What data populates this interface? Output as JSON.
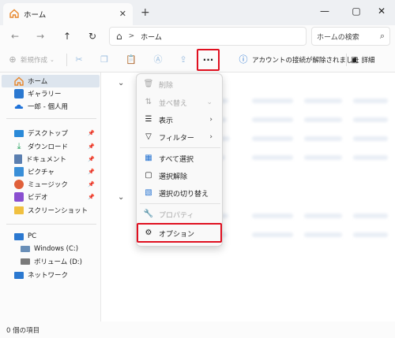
{
  "tab": {
    "title": "ホーム",
    "close": "✕",
    "new": "+"
  },
  "window": {
    "minimize": "—",
    "maximize": "▢",
    "close": "✕"
  },
  "nav": {
    "back": "←",
    "forward": "→",
    "up": "↑",
    "refresh": "↻"
  },
  "address": {
    "home_icon": "⌂",
    "separator": ">",
    "location": "ホーム"
  },
  "search": {
    "placeholder": "ホームの検索",
    "icon": "⌕"
  },
  "toolbar": {
    "new_label": "新規作成",
    "new_icon": "⊕",
    "more_label": "···",
    "info_text": "アカウントの接続が解除されました",
    "info_icon": "ⓘ",
    "detail_label": "詳細",
    "detail_icon": "▣"
  },
  "sidebar": {
    "items": [
      {
        "label": "ホーム",
        "icon": "home-icon",
        "color": "#e8862a"
      },
      {
        "label": "ギャラリー",
        "icon": "gallery-icon",
        "color": "#2b78d0"
      },
      {
        "label": "一郎 - 個人用",
        "icon": "onedrive-icon",
        "color": "#1f72d8"
      },
      {
        "label": "デスクトップ",
        "icon": "desktop-icon",
        "color": "#2b8ad8"
      },
      {
        "label": "ダウンロード",
        "icon": "download-icon",
        "color": "#1ea05a"
      },
      {
        "label": "ドキュメント",
        "icon": "document-icon",
        "color": "#5b7fb0"
      },
      {
        "label": "ピクチャ",
        "icon": "pictures-icon",
        "color": "#3a8fd8"
      },
      {
        "label": "ミュージック",
        "icon": "music-icon",
        "color": "#e0603a"
      },
      {
        "label": "ビデオ",
        "icon": "video-icon",
        "color": "#8a4fd0"
      },
      {
        "label": "スクリーンショット",
        "icon": "folder-icon",
        "color": "#f0c040"
      },
      {
        "label": "PC",
        "icon": "pc-icon",
        "color": "#2b78d0"
      },
      {
        "label": "Windows (C:)",
        "icon": "drive-icon",
        "color": "#6a8fb8"
      },
      {
        "label": "ボリューム (D:)",
        "icon": "drive-icon",
        "color": "#7a7a7a"
      },
      {
        "label": "ネットワーク",
        "icon": "network-icon",
        "color": "#2b78d0"
      }
    ]
  },
  "menu": {
    "items": [
      {
        "label": "削除",
        "icon": "🗑",
        "disabled": true
      },
      {
        "label": "並べ替え",
        "icon": "⇅",
        "disabled": true
      },
      {
        "label": "表示",
        "icon": "☰",
        "arrow": "›"
      },
      {
        "label": "フィルター",
        "icon": "▽",
        "arrow": "›"
      },
      {
        "label": "すべて選択",
        "icon": "▦"
      },
      {
        "label": "選択解除",
        "icon": "▢"
      },
      {
        "label": "選択の切り替え",
        "icon": "▧"
      },
      {
        "label": "プロパティ",
        "icon": "🔧",
        "disabled": true
      },
      {
        "label": "オプション",
        "icon": "⚙"
      }
    ]
  },
  "status": {
    "text": "0 個の項目"
  }
}
